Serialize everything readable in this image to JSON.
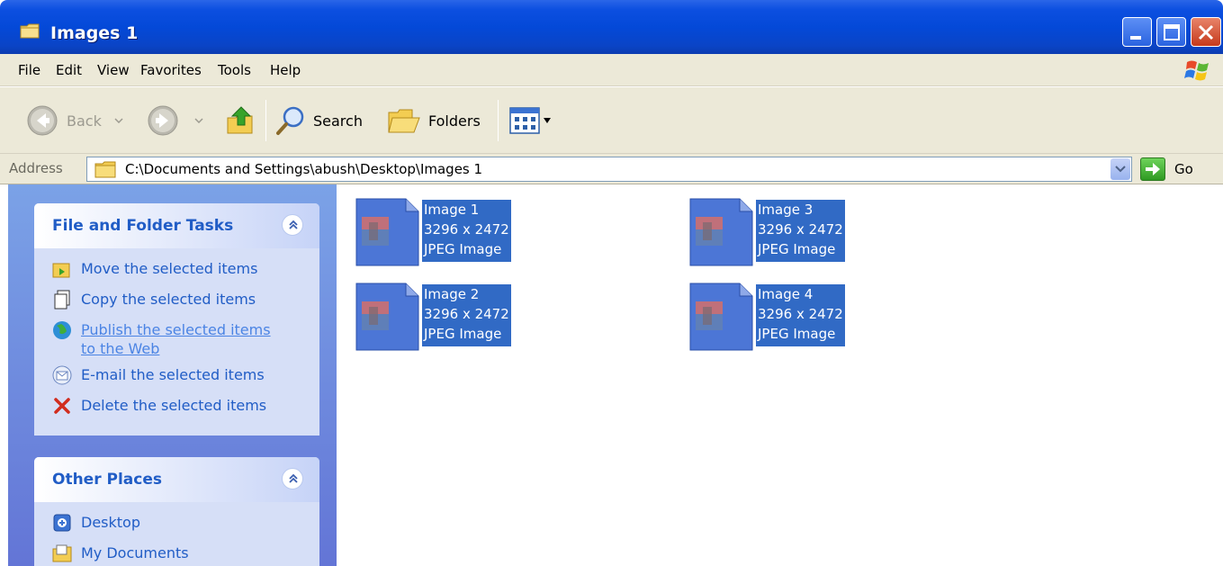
{
  "window": {
    "title": "Images 1"
  },
  "menu": [
    "File",
    "Edit",
    "View",
    "Favorites",
    "Tools",
    "Help"
  ],
  "toolbar": {
    "back_label": "Back",
    "search_label": "Search",
    "folders_label": "Folders"
  },
  "address": {
    "label": "Address",
    "path": "C:\\Documents and Settings\\abush\\Desktop\\Images 1",
    "go_label": "Go"
  },
  "tasks_panel": {
    "title": "File and Folder Tasks",
    "items": [
      {
        "label": "Move the selected items",
        "icon": "move-icon"
      },
      {
        "label": "Copy the selected items",
        "icon": "copy-icon"
      },
      {
        "label": "Publish the selected items to the Web",
        "line1": "Publish the selected items",
        "line2": "to the Web",
        "icon": "globe-icon"
      },
      {
        "label": "E-mail the selected items",
        "icon": "email-icon"
      },
      {
        "label": "Delete the selected items",
        "icon": "delete-icon"
      }
    ]
  },
  "places_panel": {
    "title": "Other Places",
    "items": [
      {
        "label": "Desktop",
        "icon": "desktop-icon"
      },
      {
        "label": "My Documents",
        "icon": "my-documents-icon"
      }
    ]
  },
  "files": [
    {
      "name": "Image 1",
      "dimensions": "3296 x 2472",
      "type": "JPEG Image"
    },
    {
      "name": "Image 2",
      "dimensions": "3296 x 2472",
      "type": "JPEG Image"
    },
    {
      "name": "Image 3",
      "dimensions": "3296 x 2472",
      "type": "JPEG Image"
    },
    {
      "name": "Image 4",
      "dimensions": "3296 x 2472",
      "type": "JPEG Image"
    }
  ],
  "colors": {
    "titlebar": "#0449d8",
    "selection": "#316ac5",
    "task_link": "#215dc6",
    "chrome": "#ece9d8"
  }
}
